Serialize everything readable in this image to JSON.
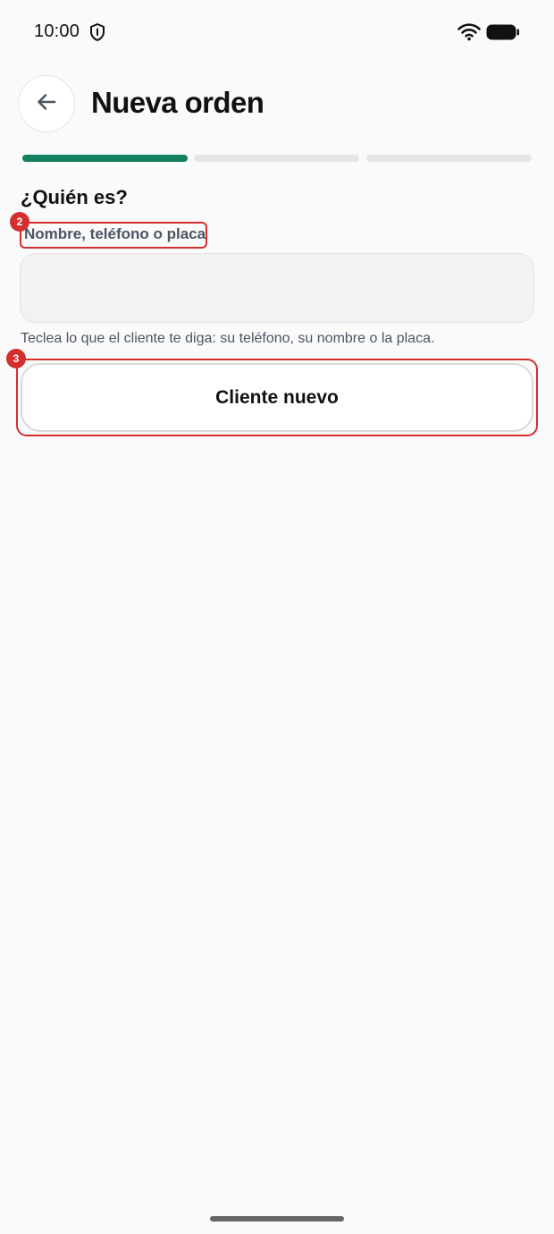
{
  "status_bar": {
    "time": "10:00",
    "icons": [
      "shield-icon",
      "wifi-icon",
      "battery-icon"
    ]
  },
  "header": {
    "title": "Nueva orden",
    "back_icon": "arrow-left-icon"
  },
  "progress": {
    "total_steps": 3,
    "current_step": 1,
    "active_color": "#138060",
    "inactive_color": "#e6e6e6"
  },
  "form": {
    "question": "¿Quién es?",
    "field_label": "Nombre, teléfono o placa",
    "field_value": "",
    "helper_text": "Teclea lo que el cliente te diga: su teléfono, su nombre o la placa.",
    "new_client_label": "Cliente nuevo"
  },
  "annotations": {
    "label_badge": "2",
    "button_badge": "3",
    "highlight_color": "#d32f2f"
  }
}
